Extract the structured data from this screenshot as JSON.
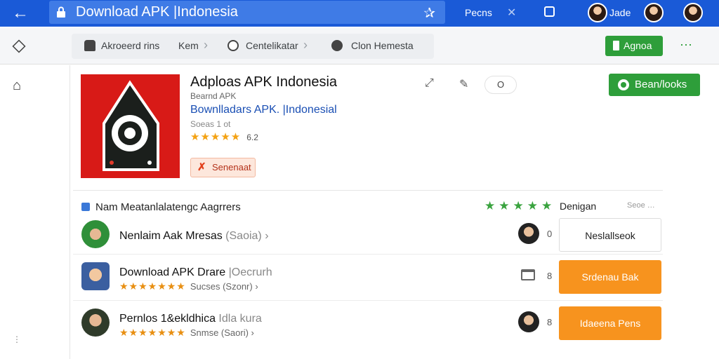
{
  "topbar": {
    "url": "Download APK |Indonesia",
    "link": "Pecns",
    "user": "Jade"
  },
  "toolbar": {
    "crumbs": [
      "Akroeerd rins",
      "Kem",
      "Centelikatar",
      "Clon Hemesta"
    ],
    "button": "Agnoa"
  },
  "app": {
    "title": "Adploas APK Indonesia",
    "subtitle": "Bearnd APK",
    "link": "Bownlladars APK. |Indonesial",
    "meta": "Soeas 1 ot",
    "stars": "★★★★★",
    "rating_count": "6.2",
    "tag": "Senenaat",
    "header_pill": "O",
    "download_button": "Bean/looks",
    "icon_colors": {
      "background": "#d81a17",
      "body": "#1b1f1c",
      "lens": "#ffffff"
    }
  },
  "section": {
    "title": "Nam Meatanlalatengc Aagrrers",
    "stars": "★★★★★",
    "right_label": "Denigan",
    "far_label": "Seoe …"
  },
  "rows": [
    {
      "title": "Nenlaim Aak Mresas",
      "title_dim": "(Saoia) ›",
      "stars": "",
      "meta": "",
      "count": "0",
      "button": "Neslallseok",
      "button_style": "outline"
    },
    {
      "title": "Download APK Drare",
      "title_dim": "|Oecrurh",
      "stars": "★★★★★★★",
      "meta": "Sucses  (Szonr) ›",
      "count": "8",
      "button": "Srdenau Bak",
      "button_style": "orange"
    },
    {
      "title": "Pernlos 1&ekldhica",
      "title_dim": "Idla kura",
      "stars": "★★★★★★★",
      "meta": "Snmse  (Saori) ›",
      "count": "8",
      "button": "Idaeena Pens",
      "button_style": "orange"
    }
  ],
  "colors": {
    "brand_blue": "#1a5ad7",
    "green": "#2e9e3a",
    "orange": "#f7931e",
    "star_gold": "#f4a213"
  }
}
